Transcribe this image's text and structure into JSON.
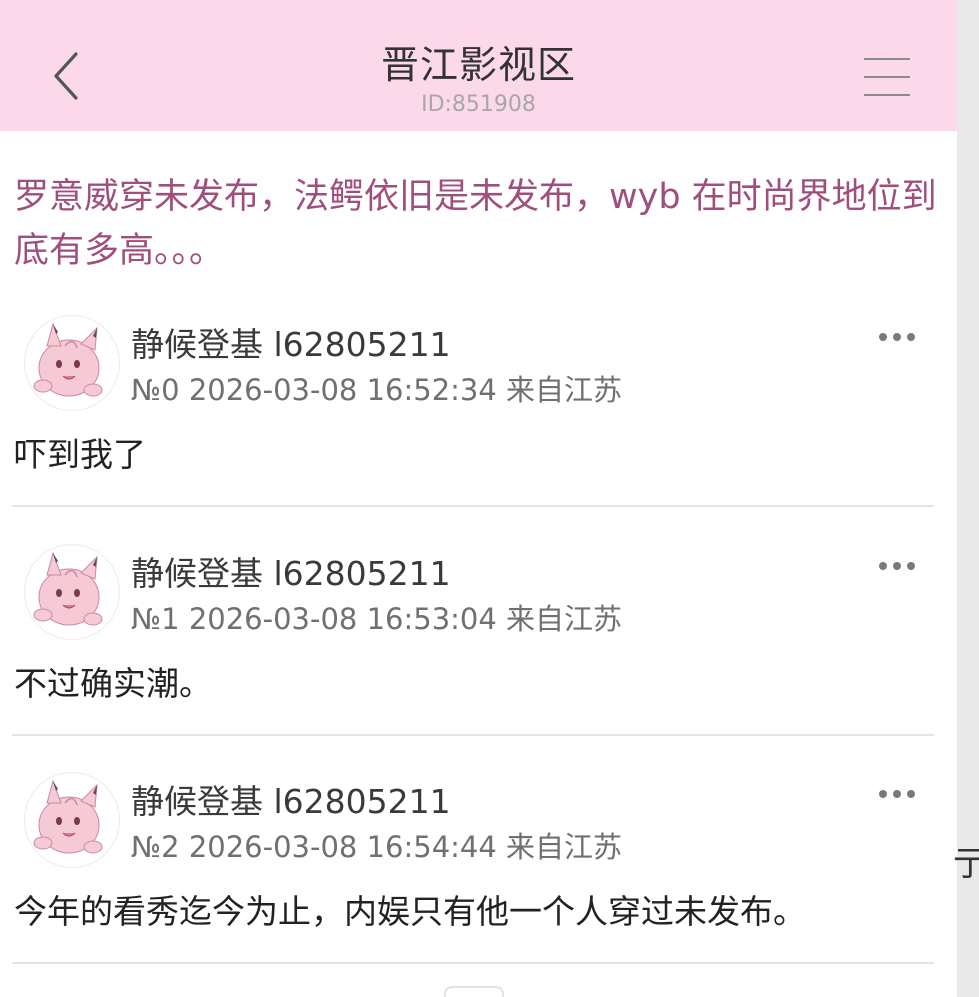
{
  "header": {
    "title": "晋江影视区",
    "subtitle": "ID:851908"
  },
  "thread": {
    "title": "罗意威穿未发布，法鳄依旧是未发布，wyb 在时尚界地位到底有多高。。。"
  },
  "posts": [
    {
      "user": "静候登基 l62805211",
      "meta": "№0 2026-03-08 16:52:34 来自江苏",
      "content": "吓到我了"
    },
    {
      "user": "静候登基 l62805211",
      "meta": "№1 2026-03-08 16:53:04 来自江苏",
      "content": "不过确实潮。"
    },
    {
      "user": "静候登基 l62805211",
      "meta": "№2 2026-03-08 16:54:44 来自江苏",
      "content": "今年的看秀迄今为止，内娱只有他一个人穿过未发布。"
    }
  ],
  "side_fragment": "亍",
  "colors": {
    "header_bg": "#fcd9ea",
    "thread_title": "#a04f7d",
    "meta_text": "#707070",
    "divider": "#e4e4e4"
  },
  "icons": {
    "back": "chevron-left-icon",
    "menu": "hamburger-menu-icon",
    "more": "more-dots-icon",
    "avatar": "pink-creature-avatar"
  }
}
